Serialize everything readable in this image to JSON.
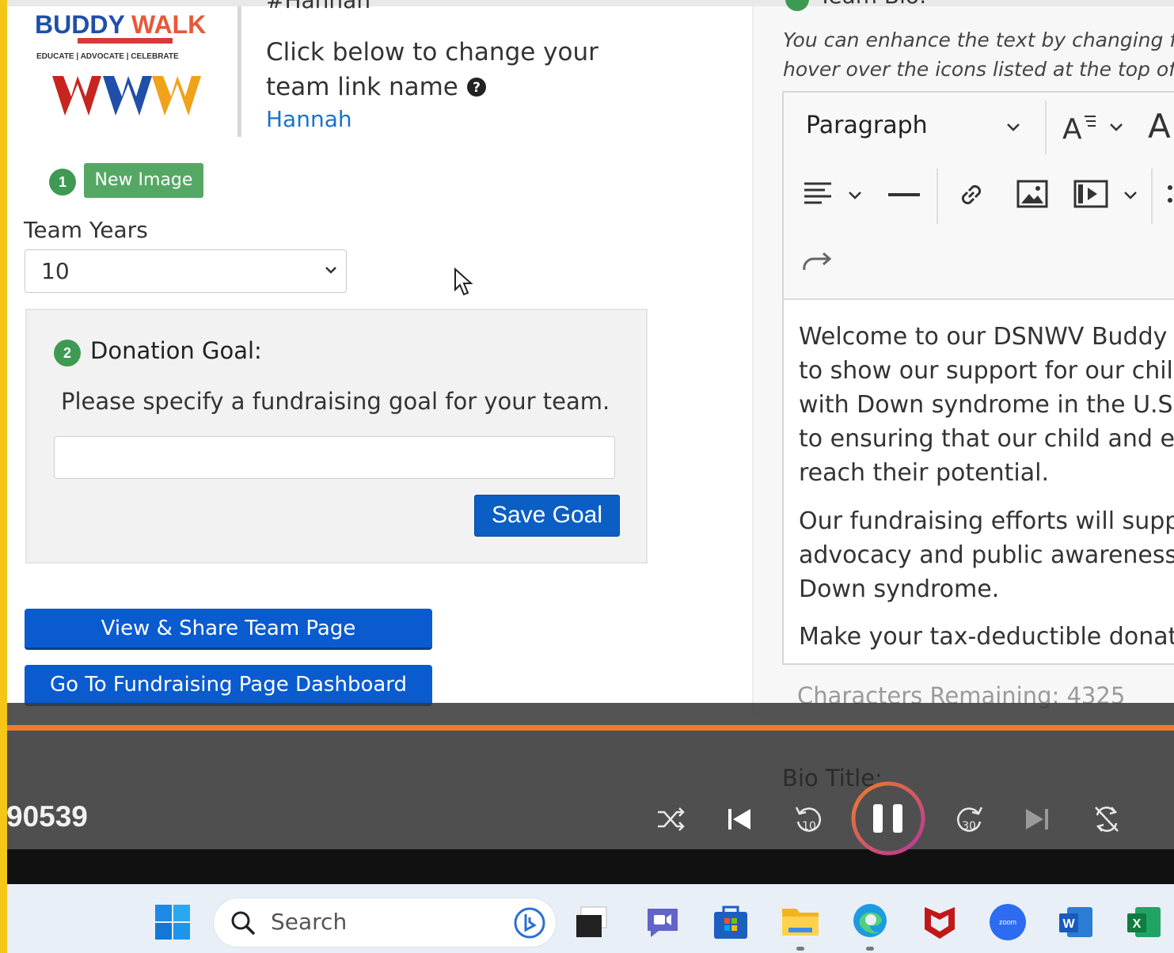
{
  "left_panel": {
    "logo": {
      "line1": "BUDDYWALK",
      "tag": "EDUCATE | ADVOCATE | CELEBRATE"
    },
    "cut_heading": "#Hannah",
    "link_description": "Click below to change your team link name",
    "help_icon": "question-circle-icon",
    "team_link_name": "Hannah",
    "step1": "1",
    "new_image_label": "New Image",
    "team_years_label": "Team Years",
    "team_years_value": "10",
    "donation": {
      "step2": "2",
      "title": "Donation Goal:",
      "description": "Please specify a fundraising goal for your team.",
      "input_value": "",
      "save_label": "Save Goal"
    },
    "view_share_label": "View & Share Team Page",
    "dashboard_label": "Go To Fundraising Page Dashboard"
  },
  "right_panel": {
    "header_cut": "Team Bio:",
    "hint": "You can enhance the text by changing font s hover over the icons listed at the top of this",
    "hint_line1": "You can enhance the text by changing font s",
    "hint_line2": "hover over the icons listed at the top of this",
    "toolbar": {
      "block_format": "Paragraph",
      "icons": [
        "font-size-icon",
        "font-icon",
        "align-icon",
        "horizontal-rule-icon",
        "link-icon",
        "image-icon",
        "media-icon",
        "more-icon",
        "redo-icon"
      ]
    },
    "bio_paragraphs": [
      [
        "Welcome to our DSNWV Buddy Wa",
        "to show our support for our child a",
        "with Down syndrome in the U.S. Ev",
        "to ensuring that our child and ever",
        "reach their potential."
      ],
      [
        "Our fundraising efforts will suppor",
        "advocacy and public awareness ini",
        "Down syndrome."
      ],
      [
        "Make your tax-deductible donation",
        ""
      ]
    ],
    "characters_remaining": "Characters Remaining: 4325",
    "bio_title_label": "Bio Title:"
  },
  "player": {
    "time": "90539",
    "progress_fraction": 1.0,
    "controls": [
      "shuffle-icon",
      "previous-icon",
      "rewind-10-icon",
      "pause-icon",
      "forward-30-icon",
      "next-icon",
      "repeat-off-icon"
    ],
    "rewind_label": "10",
    "forward_label": "30",
    "accent": "#f07c2a"
  },
  "taskbar": {
    "search_placeholder": "Search",
    "apps": [
      "windows-start-icon",
      "task-view-icon",
      "teams-chat-icon",
      "microsoft-store-icon",
      "file-explorer-icon",
      "edge-icon",
      "mcafee-icon",
      "zoom-icon",
      "word-icon",
      "excel-icon"
    ],
    "zoom_label": "zoom"
  }
}
